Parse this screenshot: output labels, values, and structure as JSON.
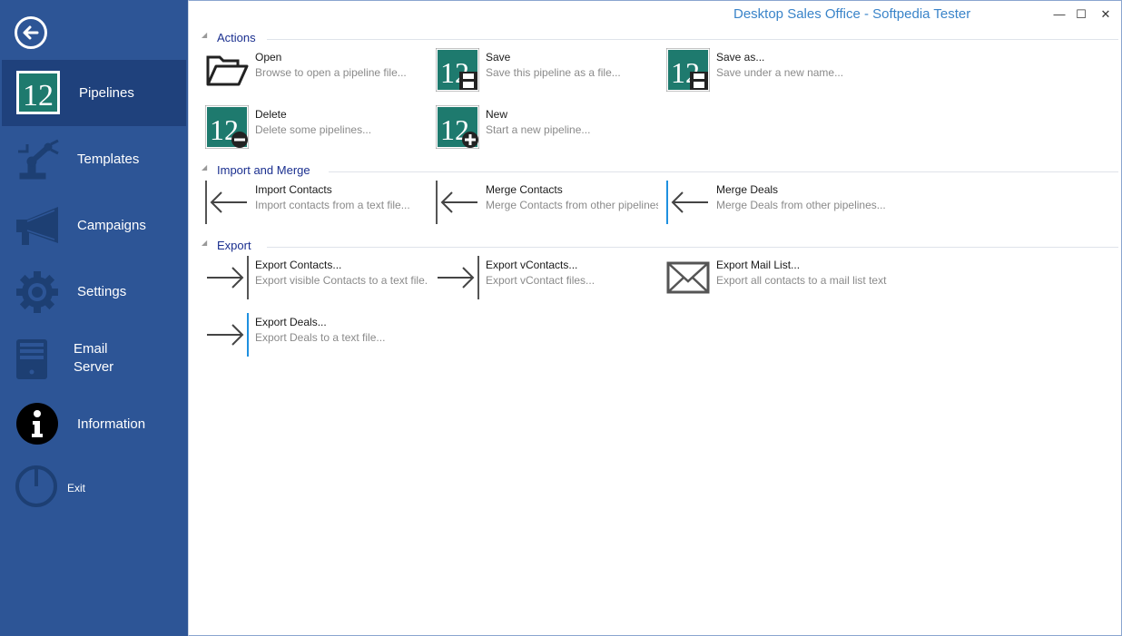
{
  "window": {
    "title": "Desktop Sales Office - Softpedia Tester",
    "buttons": {
      "minimize": "—",
      "maximize": "☐",
      "close": "✕"
    }
  },
  "sidebar": {
    "items": [
      {
        "label": "Pipelines",
        "icon": "pipeline-12-icon",
        "active": true
      },
      {
        "label": "Templates",
        "icon": "robot-arm-icon"
      },
      {
        "label": "Campaigns",
        "icon": "megaphone-icon"
      },
      {
        "label": "Settings",
        "icon": "gear-icon"
      },
      {
        "label": "Email Server",
        "icon": "server-icon"
      },
      {
        "label": "Information",
        "icon": "info-icon"
      },
      {
        "label": "Exit",
        "icon": "power-icon"
      }
    ]
  },
  "groups": {
    "actions": {
      "title": "Actions",
      "tiles": [
        {
          "name": "Open",
          "desc": "Browse to open a pipeline file..."
        },
        {
          "name": "Save",
          "desc": "Save this pipeline as a file..."
        },
        {
          "name": "Save as...",
          "desc": "Save under a new name..."
        },
        {
          "name": "Delete",
          "desc": "Delete some pipelines..."
        },
        {
          "name": "New",
          "desc": "Start a new pipeline..."
        }
      ]
    },
    "import": {
      "title": "Import and Merge",
      "tiles": [
        {
          "name": "Import Contacts",
          "desc": "Import contacts from a text file..."
        },
        {
          "name": "Merge Contacts",
          "desc": "Merge Contacts from other pipelines..."
        },
        {
          "name": "Merge Deals",
          "desc": "Merge Deals from other pipelines..."
        }
      ]
    },
    "export": {
      "title": "Export",
      "tiles": [
        {
          "name": "Export Contacts...",
          "desc": "Export visible Contacts to a text file..."
        },
        {
          "name": "Export vContacts...",
          "desc": "Export vContact files..."
        },
        {
          "name": "Export Mail List...",
          "desc": "Export all contacts to a mail list text file..."
        },
        {
          "name": "Export Deals...",
          "desc": "Export Deals to a text file..."
        }
      ]
    }
  },
  "colors": {
    "sidebar": "#2d5596",
    "sidebar_active": "#1f417c",
    "accent": "#1a2f8f",
    "title": "#3a84c9",
    "pipeline_icon": "#1e7a6e"
  }
}
